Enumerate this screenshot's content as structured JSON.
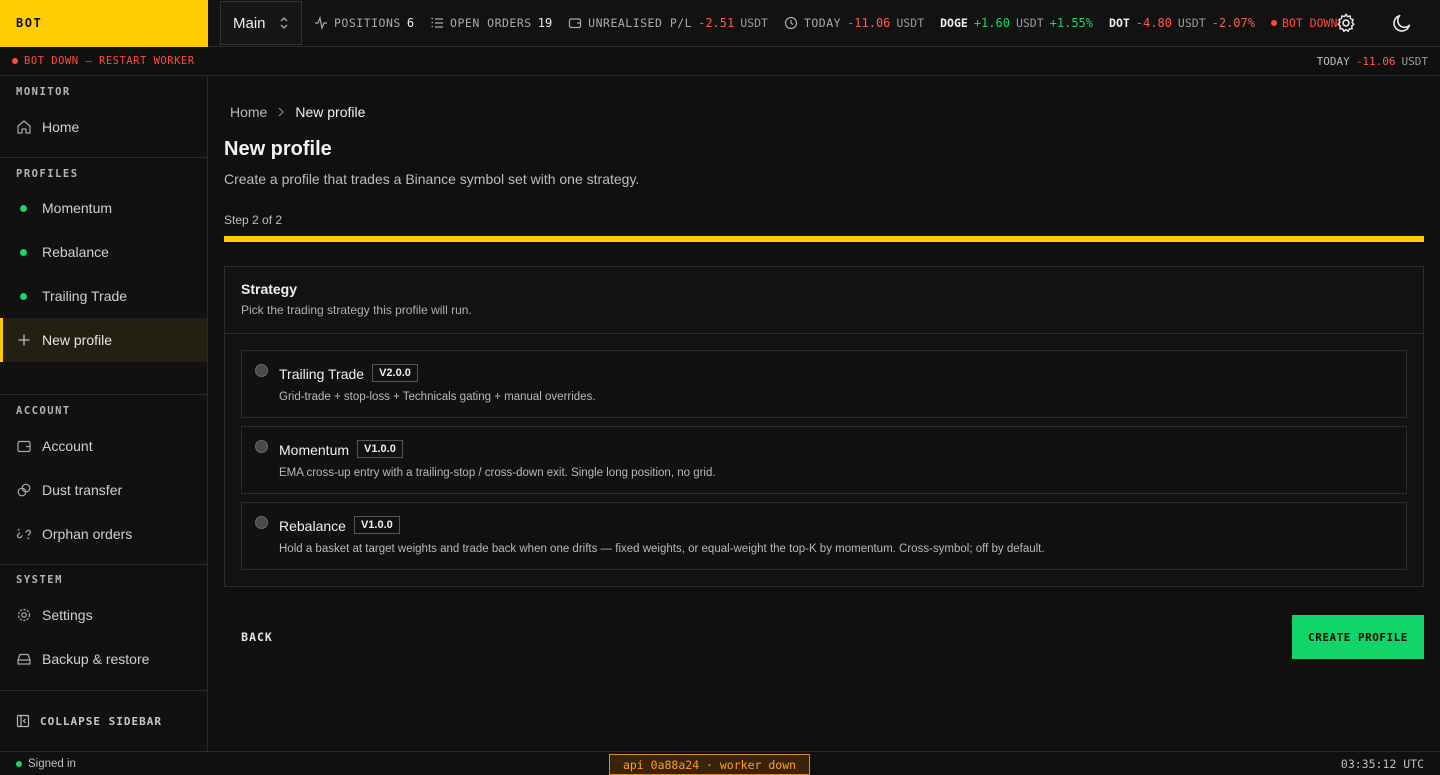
{
  "brand": "BOT",
  "account_selector": {
    "value": "Main"
  },
  "topstats": {
    "positions": {
      "label": "POSITIONS",
      "value": "6"
    },
    "open_orders": {
      "label": "OPEN ORDERS",
      "value": "19"
    },
    "unrealised": {
      "label": "UNREALISED P/L",
      "value": "-2.51",
      "unit": "USDT"
    },
    "today": {
      "label": "TODAY",
      "value": "-11.06",
      "unit": "USDT"
    },
    "doge": {
      "symbol": "DOGE",
      "value": "+1.60",
      "unit": "USDT",
      "pct": "+1.55%"
    },
    "dot": {
      "symbol": "DOT",
      "value": "-4.80",
      "unit": "USDT",
      "pct": "-2.07%"
    },
    "bot_status": "BOT DOWN"
  },
  "alert": {
    "message": "BOT DOWN — RESTART WORKER",
    "today_label": "TODAY",
    "today_value": "-11.06",
    "today_unit": "USDT"
  },
  "sidebar": {
    "monitor_title": "MONITOR",
    "home": "Home",
    "profiles_title": "PROFILES",
    "profiles": [
      "Momentum",
      "Rebalance",
      "Trailing Trade"
    ],
    "new_profile": "New profile",
    "account_title": "ACCOUNT",
    "account": "Account",
    "dust": "Dust transfer",
    "orphan": "Orphan orders",
    "system_title": "SYSTEM",
    "settings": "Settings",
    "backup": "Backup & restore",
    "collapse": "COLLAPSE SIDEBAR"
  },
  "main": {
    "breadcrumb": {
      "home": "Home",
      "current": "New profile"
    },
    "title": "New profile",
    "subtitle": "Create a profile that trades a Binance symbol set with one strategy.",
    "step": "Step 2 of 2",
    "progress_fraction": 1.0,
    "card": {
      "title": "Strategy",
      "subtitle": "Pick the trading strategy this profile will run.",
      "options": [
        {
          "name": "Trailing Trade",
          "version": "V2.0.0",
          "desc": "Grid-trade + stop-loss + Technicals gating + manual overrides."
        },
        {
          "name": "Momentum",
          "version": "V1.0.0",
          "desc": "EMA cross-up entry with a trailing-stop / cross-down exit. Single long position, no grid."
        },
        {
          "name": "Rebalance",
          "version": "V1.0.0",
          "desc": "Hold a basket at target weights and trade back when one drifts — fixed weights, or equal-weight the top-K by momentum. Cross-symbol; off by default."
        }
      ]
    },
    "back": "BACK",
    "create": "CREATE PROFILE"
  },
  "footer": {
    "signed_in": "Signed in",
    "api": "api 0a88a24 · worker down",
    "time": "03:35:12 UTC"
  },
  "colors": {
    "accent": "#ffcc00",
    "positive": "#17d66c",
    "negative": "#ff5a4f",
    "create": "#12d56a"
  }
}
